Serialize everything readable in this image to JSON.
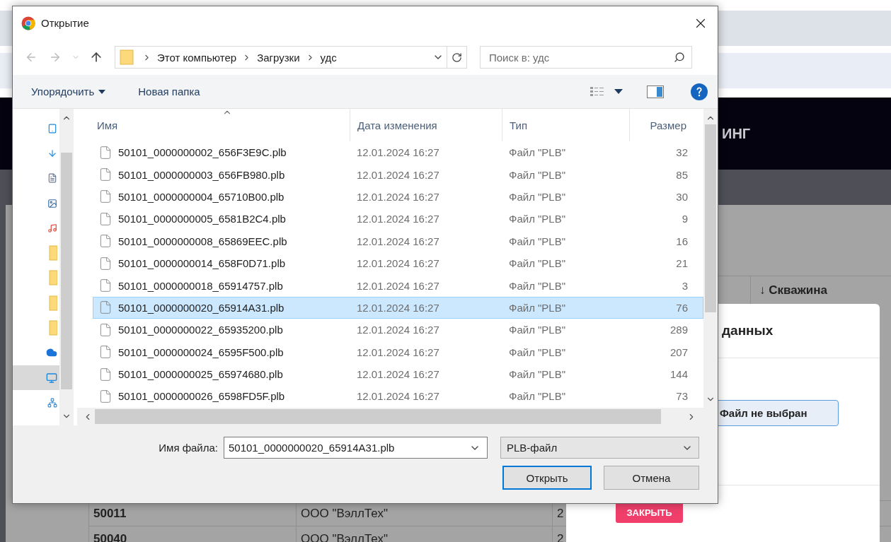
{
  "background_page": {
    "header_text": "ИНГ",
    "table": {
      "column_4": "↓ Скважина",
      "rows": [
        {
          "cells": [
            "50011",
            "ООО \"ВэллТех\"",
            "2"
          ]
        },
        {
          "cells": [
            "50040",
            "ООО \"ВэллТех\"",
            "2"
          ]
        }
      ]
    },
    "modal": {
      "title": "данных",
      "file_button": "Файл не выбран",
      "close_button": "ЗАКРЫТЬ"
    }
  },
  "dialog": {
    "title": "Открытие",
    "breadcrumbs": [
      "Этот компьютер",
      "Загрузки",
      "удс"
    ],
    "search": {
      "placeholder": "Поиск в: удс"
    },
    "toolbar": {
      "organize": "Упорядочить",
      "new_folder": "Новая папка"
    },
    "nav_pane": [
      {
        "kind": "desktop",
        "selected": false
      },
      {
        "kind": "downloads",
        "selected": false
      },
      {
        "kind": "documents",
        "selected": false
      },
      {
        "kind": "pictures",
        "selected": false
      },
      {
        "kind": "music",
        "selected": false
      },
      {
        "kind": "folder",
        "selected": false
      },
      {
        "kind": "folder",
        "selected": false
      },
      {
        "kind": "folder",
        "selected": false
      },
      {
        "kind": "folder",
        "selected": false
      },
      {
        "kind": "cloud",
        "selected": false
      },
      {
        "kind": "computer",
        "selected": true
      },
      {
        "kind": "network",
        "selected": false
      }
    ],
    "columns": [
      "Имя",
      "Дата изменения",
      "Тип",
      "Размер"
    ],
    "files": [
      {
        "name": "50101_0000000002_656F3E9C.plb",
        "date": "12.01.2024 16:27",
        "type": "Файл \"PLB\"",
        "size": "32",
        "selected": false
      },
      {
        "name": "50101_0000000003_656FB980.plb",
        "date": "12.01.2024 16:27",
        "type": "Файл \"PLB\"",
        "size": "85",
        "selected": false
      },
      {
        "name": "50101_0000000004_65710B00.plb",
        "date": "12.01.2024 16:27",
        "type": "Файл \"PLB\"",
        "size": "30",
        "selected": false
      },
      {
        "name": "50101_0000000005_6581B2C4.plb",
        "date": "12.01.2024 16:27",
        "type": "Файл \"PLB\"",
        "size": "9",
        "selected": false
      },
      {
        "name": "50101_0000000008_65869EEC.plb",
        "date": "12.01.2024 16:27",
        "type": "Файл \"PLB\"",
        "size": "16",
        "selected": false
      },
      {
        "name": "50101_0000000014_658F0D71.plb",
        "date": "12.01.2024 16:27",
        "type": "Файл \"PLB\"",
        "size": "21",
        "selected": false
      },
      {
        "name": "50101_0000000018_65914757.plb",
        "date": "12.01.2024 16:27",
        "type": "Файл \"PLB\"",
        "size": "3",
        "selected": false
      },
      {
        "name": "50101_0000000020_65914A31.plb",
        "date": "12.01.2024 16:27",
        "type": "Файл \"PLB\"",
        "size": "76",
        "selected": true
      },
      {
        "name": "50101_0000000022_65935200.plb",
        "date": "12.01.2024 16:27",
        "type": "Файл \"PLB\"",
        "size": "289",
        "selected": false
      },
      {
        "name": "50101_0000000024_6595F500.plb",
        "date": "12.01.2024 16:27",
        "type": "Файл \"PLB\"",
        "size": "207",
        "selected": false
      },
      {
        "name": "50101_0000000025_65974680.plb",
        "date": "12.01.2024 16:27",
        "type": "Файл \"PLB\"",
        "size": "144",
        "selected": false
      },
      {
        "name": "50101_0000000026_6598FD5F.plb",
        "date": "12.01.2024 16:27",
        "type": "Файл \"PLB\"",
        "size": "73",
        "selected": false
      }
    ],
    "filename_label": "Имя файла:",
    "filename_value": "50101_0000000020_65914A31.plb",
    "filetype": "PLB-файл",
    "buttons": {
      "open": "Открыть",
      "cancel": "Отмена"
    }
  }
}
